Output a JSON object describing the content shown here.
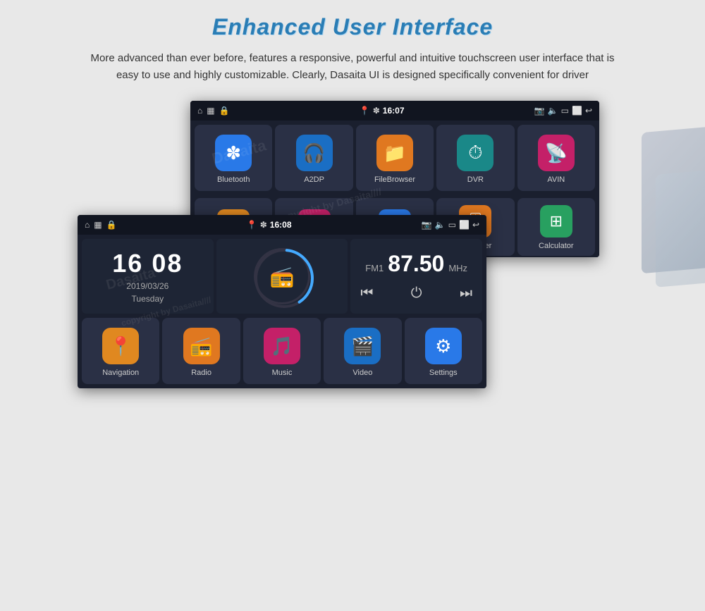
{
  "page": {
    "title": "Enhanced User Interface",
    "subtitle": "More advanced than ever before, features a responsive, powerful and intuitive touchscreen user interface that is easy to use and highly customizable. Clearly, Dasaita UI is designed specifically convenient for driver"
  },
  "screen_top": {
    "status": {
      "time": "16:07",
      "icons_left": [
        "home",
        "image",
        "lock"
      ],
      "icons_right": [
        "location",
        "bluetooth",
        "signal",
        "camera",
        "volume",
        "window",
        "tablet",
        "back"
      ]
    },
    "apps_row1": [
      {
        "label": "Bluetooth",
        "icon": "✽",
        "color_class": "ic-blue"
      },
      {
        "label": "A2DP",
        "icon": "🎧",
        "color_class": "ic-blue2"
      },
      {
        "label": "FileBrowser",
        "icon": "📁",
        "color_class": "ic-orange"
      },
      {
        "label": "DVR",
        "icon": "⏱",
        "color_class": "ic-teal"
      },
      {
        "label": "AVIN",
        "icon": "🔌",
        "color_class": "ic-pink"
      }
    ],
    "apps_row2_partial": [
      {
        "label": "",
        "icon": "🖼",
        "color_class": "ic-orange2"
      },
      {
        "label": "",
        "icon": "⬡",
        "color_class": "ic-pink"
      },
      {
        "label": "",
        "icon": "🚗",
        "color_class": "ic-blue"
      },
      {
        "label": "Equalizer",
        "icon": "🎚",
        "color_class": "ic-orange"
      },
      {
        "label": "Calculator",
        "icon": "⊞",
        "color_class": "ic-green2"
      }
    ]
  },
  "screen_bottom": {
    "status": {
      "time": "16:08",
      "icons_left": [
        "home",
        "image",
        "lock"
      ],
      "icons_right": [
        "location",
        "bluetooth",
        "signal",
        "camera",
        "volume",
        "window",
        "tablet",
        "back"
      ]
    },
    "clock": {
      "time": "16 08",
      "date": "2019/03/26",
      "day": "Tuesday"
    },
    "radio": {
      "band": "FM1",
      "frequency": "87.50",
      "unit": "MHz"
    },
    "apps": [
      {
        "label": "Navigation",
        "icon": "📍",
        "color_class": "ic-orange2"
      },
      {
        "label": "Radio",
        "icon": "📻",
        "color_class": "ic-orange"
      },
      {
        "label": "Music",
        "icon": "🎵",
        "color_class": "ic-pink"
      },
      {
        "label": "Video",
        "icon": "🎬",
        "color_class": "ic-blue2"
      },
      {
        "label": "Settings",
        "icon": "⚙",
        "color_class": "ic-blue"
      }
    ]
  },
  "watermark": "Dasaita"
}
